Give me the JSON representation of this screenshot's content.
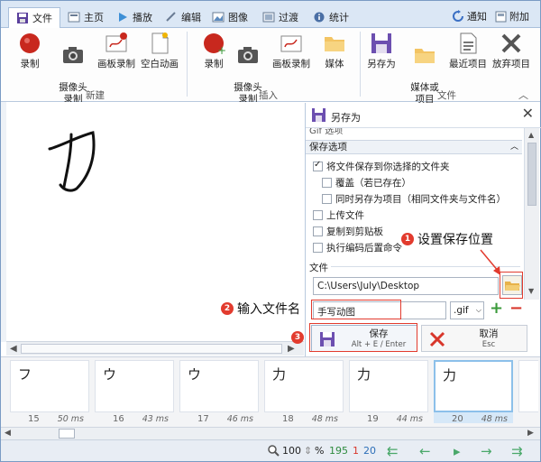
{
  "tabs": [
    {
      "label": "文件",
      "active": true
    },
    {
      "label": "主页"
    },
    {
      "label": "播放"
    },
    {
      "label": "编辑"
    },
    {
      "label": "图像"
    },
    {
      "label": "过渡"
    },
    {
      "label": "统计"
    }
  ],
  "topright": {
    "notify": "通知",
    "addon": "附加"
  },
  "ribbon": {
    "new": {
      "label": "新建",
      "buttons": [
        "录制",
        "摄像头\n录制",
        "画板录制",
        "空白动画"
      ]
    },
    "insert": {
      "label": "插入",
      "buttons": [
        "录制",
        "摄像头\n录制",
        "画板录制",
        "媒体"
      ]
    },
    "file": {
      "label": "文件",
      "buttons": [
        "另存为",
        "媒体或\n项目",
        "最近项目",
        "放弃项目"
      ]
    }
  },
  "panel": {
    "title": "另存为",
    "gif_options": "Gif 选项",
    "save_options": "保存选项",
    "checks": [
      {
        "label": "将文件保存到你选择的文件夹",
        "checked": true
      },
      {
        "label": "覆盖（若已存在）",
        "checked": false
      },
      {
        "label": "同时另存为项目（相同文件夹与文件名）",
        "checked": false
      },
      {
        "label": "上传文件",
        "checked": false
      },
      {
        "label": "复制到剪贴板",
        "checked": false
      },
      {
        "label": "执行编码后置命令",
        "checked": false
      }
    ],
    "file_label": "文件",
    "path": "C:\\Users\\July\\Desktop",
    "filename": "手写动图",
    "ext": ".gif",
    "save": {
      "label": "保存",
      "shortcut": "Alt + E / Enter"
    },
    "cancel": {
      "label": "取消",
      "shortcut": "Esc"
    }
  },
  "annotations": {
    "a1": {
      "num": "1",
      "text": "设置保存位置"
    },
    "a2": {
      "num": "2",
      "text": "输入文件名"
    },
    "a3": {
      "num": "3"
    }
  },
  "canvas_glyph": "力",
  "frames": [
    {
      "idx": "15",
      "ms": "50 ms",
      "glyph": "フ"
    },
    {
      "idx": "16",
      "ms": "43 ms",
      "glyph": "ウ"
    },
    {
      "idx": "17",
      "ms": "46 ms",
      "glyph": "ウ"
    },
    {
      "idx": "18",
      "ms": "48 ms",
      "glyph": "力"
    },
    {
      "idx": "19",
      "ms": "44 ms",
      "glyph": "力"
    },
    {
      "idx": "20",
      "ms": "48 ms",
      "glyph": "力",
      "selected": true
    },
    {
      "idx": "",
      "ms": "",
      "glyph": ""
    }
  ],
  "status": {
    "zoom": "100",
    "percent": "%",
    "total": "195",
    "selected": "1",
    "current": "20"
  }
}
